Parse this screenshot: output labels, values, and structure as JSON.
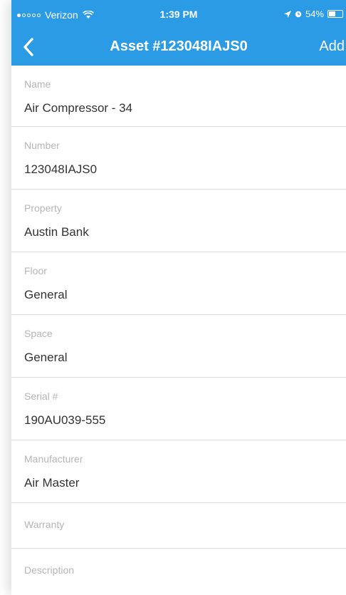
{
  "status_bar": {
    "carrier": "Verizon",
    "time": "1:39 PM",
    "battery": "54%",
    "battery_level": 0.54
  },
  "nav": {
    "title": "Asset #123048IAJS0",
    "add_label": "Add",
    "back_icon": "chevron-left-icon"
  },
  "fields": [
    {
      "label": "Name",
      "value": "Air Compressor - 34"
    },
    {
      "label": "Number",
      "value": "123048IAJS0"
    },
    {
      "label": "Property",
      "value": "Austin Bank"
    },
    {
      "label": "Floor",
      "value": "General"
    },
    {
      "label": "Space",
      "value": "General"
    },
    {
      "label": "Serial #",
      "value": "190AU039-555"
    },
    {
      "label": "Manufacturer",
      "value": "Air Master"
    },
    {
      "label": "Warranty",
      "value": ""
    },
    {
      "label": "Description",
      "value": ""
    }
  ],
  "colors": {
    "accent": "#2b9be6",
    "label": "#b5b5b5",
    "value": "#333333",
    "divider": "#dcdcdc"
  }
}
